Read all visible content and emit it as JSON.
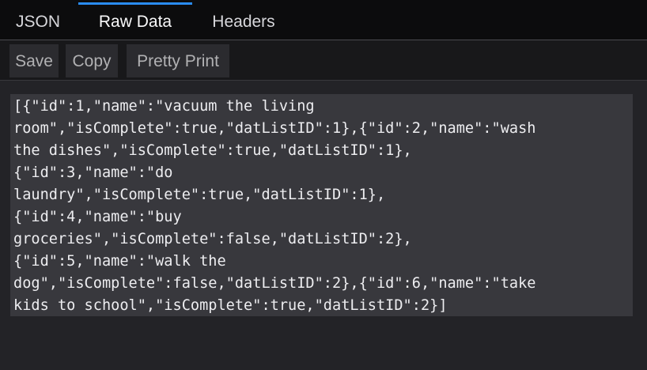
{
  "tabs": [
    {
      "label": "JSON",
      "active": false
    },
    {
      "label": "Raw Data",
      "active": true
    },
    {
      "label": "Headers",
      "active": false
    }
  ],
  "toolbar": {
    "save_label": "Save",
    "copy_label": "Copy",
    "pretty_print_label": "Pretty Print"
  },
  "raw_lines": [
    "[{\"id\":1,\"name\":\"vacuum the living",
    "room\",\"isComplete\":true,\"datListID\":1},{\"id\":2,\"name\":\"wash",
    "the dishes\",\"isComplete\":true,\"datListID\":1},",
    "{\"id\":3,\"name\":\"do",
    "laundry\",\"isComplete\":true,\"datListID\":1},",
    "{\"id\":4,\"name\":\"buy",
    "groceries\",\"isComplete\":false,\"datListID\":2},",
    "{\"id\":5,\"name\":\"walk the",
    "dog\",\"isComplete\":false,\"datListID\":2},{\"id\":6,\"name\":\"take",
    "kids to school\",\"isComplete\":true,\"datListID\":2}]"
  ],
  "colors": {
    "accent": "#2a8cf0",
    "tabbar_bg": "#0c0c0d",
    "content_bg": "#232327",
    "raw_bg": "#38383d"
  }
}
